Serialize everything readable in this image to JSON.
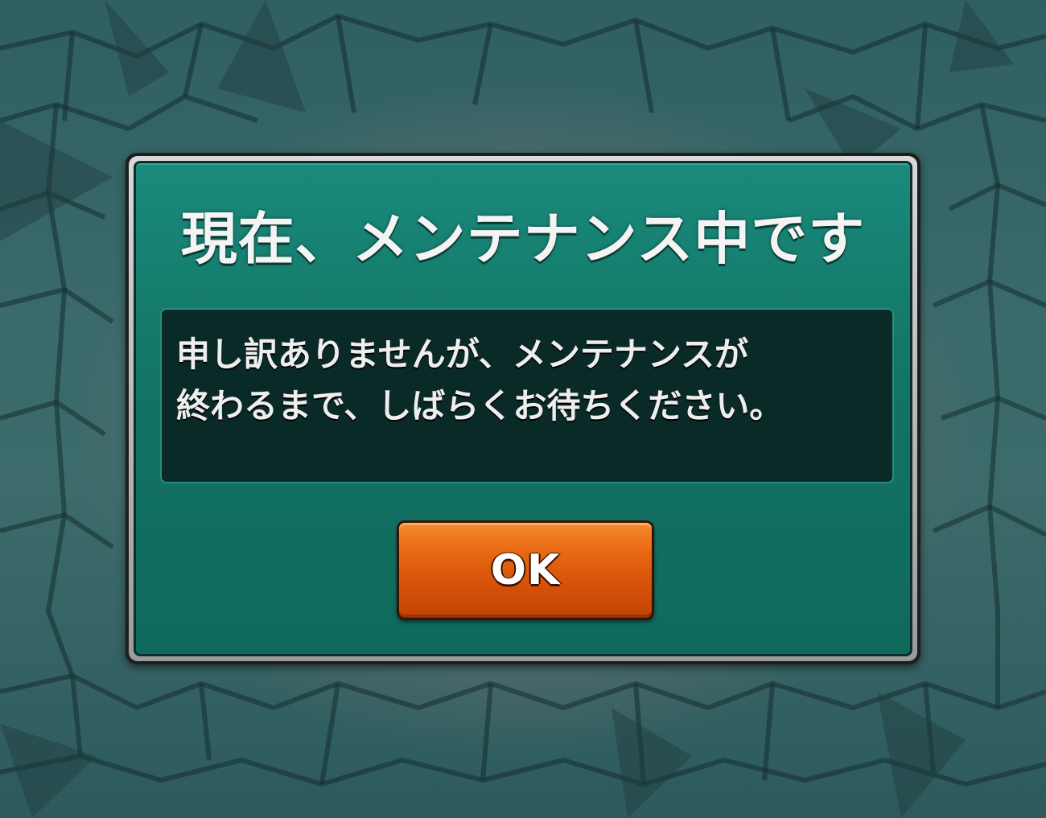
{
  "dialog": {
    "title": "現在、メンテナンス中です",
    "message_lines": [
      "申し訳ありませんが、メンテナンスが",
      "終わるまで、しばらくお待ちください。"
    ],
    "ok_label": "OK"
  },
  "colors": {
    "dialog_fill": "#127464",
    "message_box_fill": "#0a2a27",
    "ok_button": "#e0600e",
    "text": "#f4f4f4"
  }
}
